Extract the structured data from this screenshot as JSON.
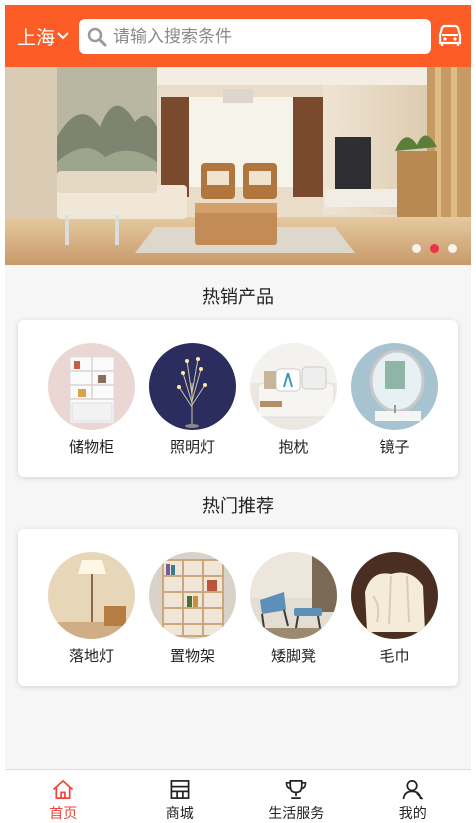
{
  "header": {
    "city": "上海",
    "search_placeholder": "请输入搜索条件"
  },
  "banner": {
    "slide_count": 3,
    "active_slide": 2
  },
  "hot_products": {
    "title": "热销产品",
    "items": [
      {
        "label": "储物柜",
        "icon": "storage-cabinet"
      },
      {
        "label": "照明灯",
        "icon": "lighting-lamp"
      },
      {
        "label": "抱枕",
        "icon": "pillow"
      },
      {
        "label": "镜子",
        "icon": "mirror"
      }
    ]
  },
  "recommended": {
    "title": "热门推荐",
    "items": [
      {
        "label": "落地灯",
        "icon": "floor-lamp"
      },
      {
        "label": "置物架",
        "icon": "shelf"
      },
      {
        "label": "矮脚凳",
        "icon": "low-stool"
      },
      {
        "label": "毛巾",
        "icon": "towel"
      }
    ]
  },
  "tabbar": {
    "active_index": 0,
    "tabs": [
      {
        "label": "首页",
        "icon": "home-icon"
      },
      {
        "label": "商城",
        "icon": "store-icon"
      },
      {
        "label": "生活服务",
        "icon": "trophy-icon"
      },
      {
        "label": "我的",
        "icon": "user-icon"
      }
    ]
  },
  "colors": {
    "brand": "#fc5c25",
    "active_tab": "#f0453a",
    "active_dot": "#e8334a"
  }
}
